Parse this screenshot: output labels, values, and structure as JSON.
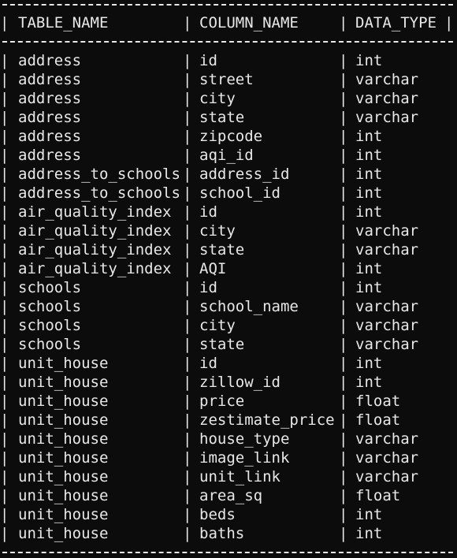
{
  "table": {
    "headers": [
      "TABLE_NAME",
      "COLUMN_NAME",
      "DATA_TYPE"
    ],
    "rows": [
      [
        "address",
        "id",
        "int"
      ],
      [
        "address",
        "street",
        "varchar"
      ],
      [
        "address",
        "city",
        "varchar"
      ],
      [
        "address",
        "state",
        "varchar"
      ],
      [
        "address",
        "zipcode",
        "int"
      ],
      [
        "address",
        "aqi_id",
        "int"
      ],
      [
        "address_to_schools",
        "address_id",
        "int"
      ],
      [
        "address_to_schools",
        "school_id",
        "int"
      ],
      [
        "air_quality_index",
        "id",
        "int"
      ],
      [
        "air_quality_index",
        "city",
        "varchar"
      ],
      [
        "air_quality_index",
        "state",
        "varchar"
      ],
      [
        "air_quality_index",
        "AQI",
        "int"
      ],
      [
        "schools",
        "id",
        "int"
      ],
      [
        "schools",
        "school_name",
        "varchar"
      ],
      [
        "schools",
        "city",
        "varchar"
      ],
      [
        "schools",
        "state",
        "varchar"
      ],
      [
        "unit_house",
        "id",
        "int"
      ],
      [
        "unit_house",
        "zillow_id",
        "int"
      ],
      [
        "unit_house",
        "price",
        "float"
      ],
      [
        "unit_house",
        "zestimate_price",
        "float"
      ],
      [
        "unit_house",
        "house_type",
        "varchar"
      ],
      [
        "unit_house",
        "image_link",
        "varchar"
      ],
      [
        "unit_house",
        "unit_link",
        "varchar"
      ],
      [
        "unit_house",
        "area_sq",
        "float"
      ],
      [
        "unit_house",
        "beds",
        "int"
      ],
      [
        "unit_house",
        "baths",
        "int"
      ]
    ]
  },
  "theme": {
    "background": "#0c0c0c",
    "foreground": "#e8e8e8"
  }
}
